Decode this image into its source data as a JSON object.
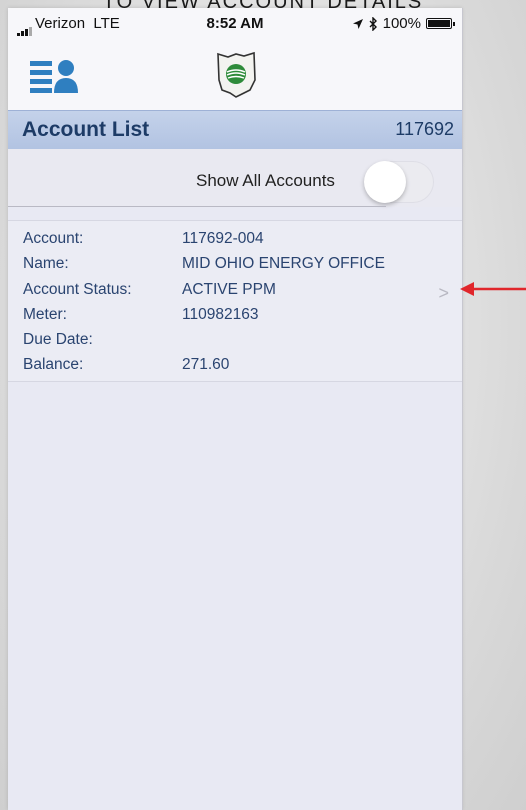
{
  "caption": "TO VIEW ACCOUNT DETAILS",
  "status_bar": {
    "carrier": "Verizon",
    "network": "LTE",
    "time": "8:52 AM",
    "location_icon": "location-arrow-icon",
    "bluetooth_icon": "bluetooth-icon",
    "battery_percent": "100%",
    "battery_level": 1.0
  },
  "nav": {
    "menu_icon": "account-menu-icon",
    "logo_icon": "ohio-state-logo-icon"
  },
  "header": {
    "title": "Account List",
    "account_number": "117692"
  },
  "toggle": {
    "label": "Show All Accounts",
    "state": "off"
  },
  "account": {
    "rows": [
      {
        "label": "Account:",
        "value": "117692-004"
      },
      {
        "label": "Name:",
        "value": "MID OHIO ENERGY OFFICE"
      },
      {
        "label": "Account Status:",
        "value": "ACTIVE PPM"
      },
      {
        "label": "Meter:",
        "value": "110982163"
      },
      {
        "label": "Due Date:",
        "value": ""
      },
      {
        "label": "Balance:",
        "value": "271.60"
      }
    ],
    "chevron": ">"
  },
  "colors": {
    "header_band": "#b7c7e4",
    "header_text": "#1d3b66",
    "field_text": "#2a4470",
    "arrow": "#e0262b",
    "menu_icon": "#2f7fc0",
    "logo_green": "#2e8b3a"
  }
}
